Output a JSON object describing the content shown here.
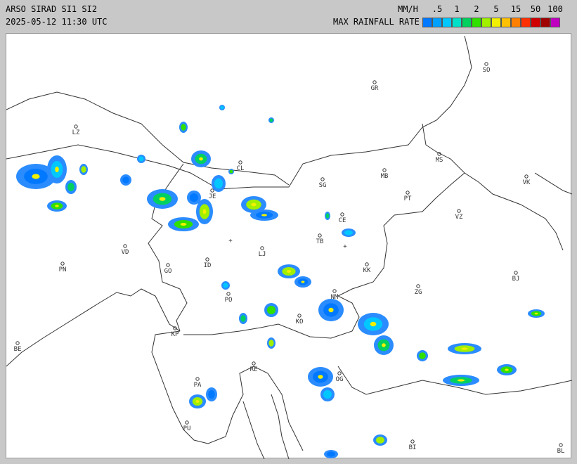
{
  "header": {
    "title": "ARSO SIRAD SI1 SI2",
    "timestamp": "2025-05-12 11:30 UTC",
    "units": "MM/H",
    "legend_label": "MAX RAINFALL RATE"
  },
  "scale": {
    "ticks": [
      ".5",
      "1",
      "2",
      "5",
      "15",
      "50",
      "100"
    ],
    "colors": [
      "#0078ff",
      "#00a0ff",
      "#00c8ff",
      "#00e0c8",
      "#00d060",
      "#30e000",
      "#a0f000",
      "#f0f000",
      "#ffc000",
      "#ff8000",
      "#ff3000",
      "#d00000",
      "#a00000",
      "#c000c0"
    ]
  },
  "cities": [
    {
      "code": "SO"
    },
    {
      "code": "GR"
    },
    {
      "code": "LZ"
    },
    {
      "code": "CL"
    },
    {
      "code": "JE"
    },
    {
      "code": "MS"
    },
    {
      "code": "MB"
    },
    {
      "code": "SG"
    },
    {
      "code": "VK"
    },
    {
      "code": "PT"
    },
    {
      "code": "CE"
    },
    {
      "code": "VZ"
    },
    {
      "code": "TB"
    },
    {
      "code": "VD"
    },
    {
      "code": "LJ"
    },
    {
      "code": "KK"
    },
    {
      "code": "PN"
    },
    {
      "code": "GO"
    },
    {
      "code": "ID"
    },
    {
      "code": "BJ"
    },
    {
      "code": "PO"
    },
    {
      "code": "NM"
    },
    {
      "code": "ZG"
    },
    {
      "code": "KO"
    },
    {
      "code": "KP"
    },
    {
      "code": "BE"
    },
    {
      "code": "RE"
    },
    {
      "code": "OG"
    },
    {
      "code": "PA"
    },
    {
      "code": "PU"
    },
    {
      "code": "BI"
    },
    {
      "code": "BL"
    }
  ]
}
